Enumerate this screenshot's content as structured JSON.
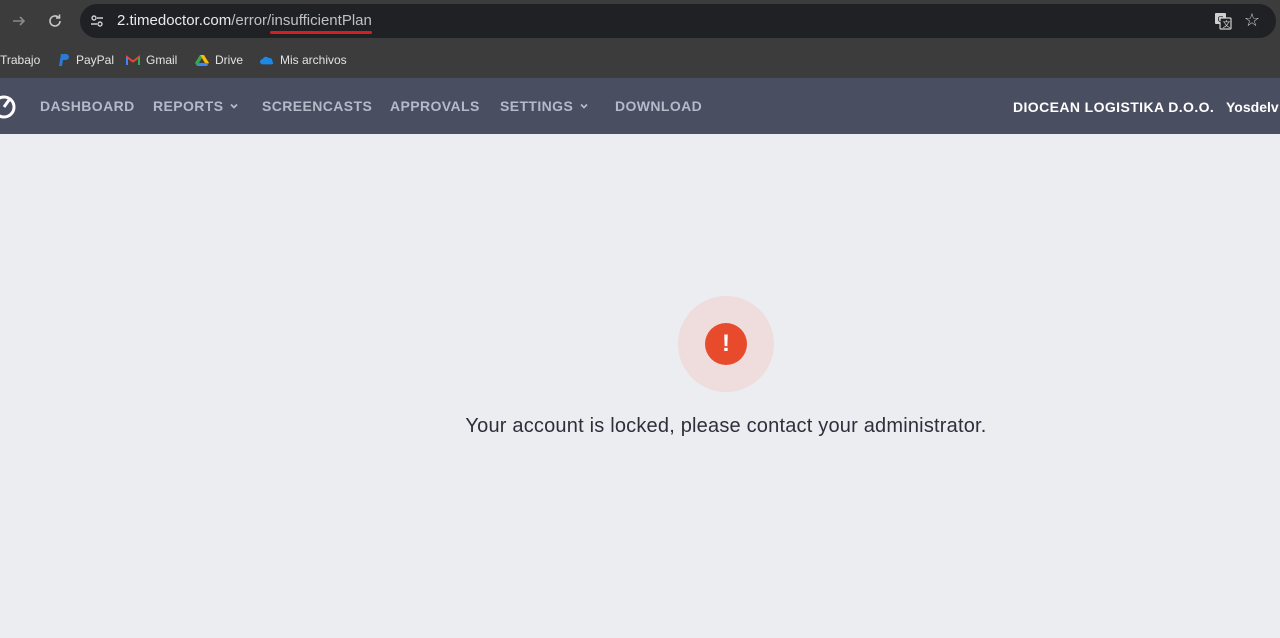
{
  "browser": {
    "url_host": "2.timedoctor.com",
    "url_path": "/error/insufficientPlan",
    "bookmarks": [
      {
        "label": "Trabajo",
        "icon": "folder-icon"
      },
      {
        "label": "PayPal",
        "icon": "paypal-icon"
      },
      {
        "label": "Gmail",
        "icon": "gmail-icon"
      },
      {
        "label": "Drive",
        "icon": "drive-icon"
      },
      {
        "label": "Mis archivos",
        "icon": "onedrive-icon"
      }
    ]
  },
  "nav": {
    "items": [
      {
        "label": "DASHBOARD",
        "dropdown": false
      },
      {
        "label": "REPORTS",
        "dropdown": true
      },
      {
        "label": "SCREENCASTS",
        "dropdown": false
      },
      {
        "label": "APPROVALS",
        "dropdown": false
      },
      {
        "label": "SETTINGS",
        "dropdown": true
      },
      {
        "label": "DOWNLOAD",
        "dropdown": false
      }
    ],
    "company": "DIOCEAN LOGISTIKA D.O.O.",
    "user": "Yosdelv"
  },
  "main": {
    "alert_symbol": "!",
    "message": "Your account is locked, please contact your administrator."
  },
  "colors": {
    "nav_bg": "#4a4e61",
    "page_bg": "#ecedf1",
    "alert_red": "#e84a2c",
    "alert_halo": "#efdcdc",
    "url_underline": "#d22020"
  }
}
